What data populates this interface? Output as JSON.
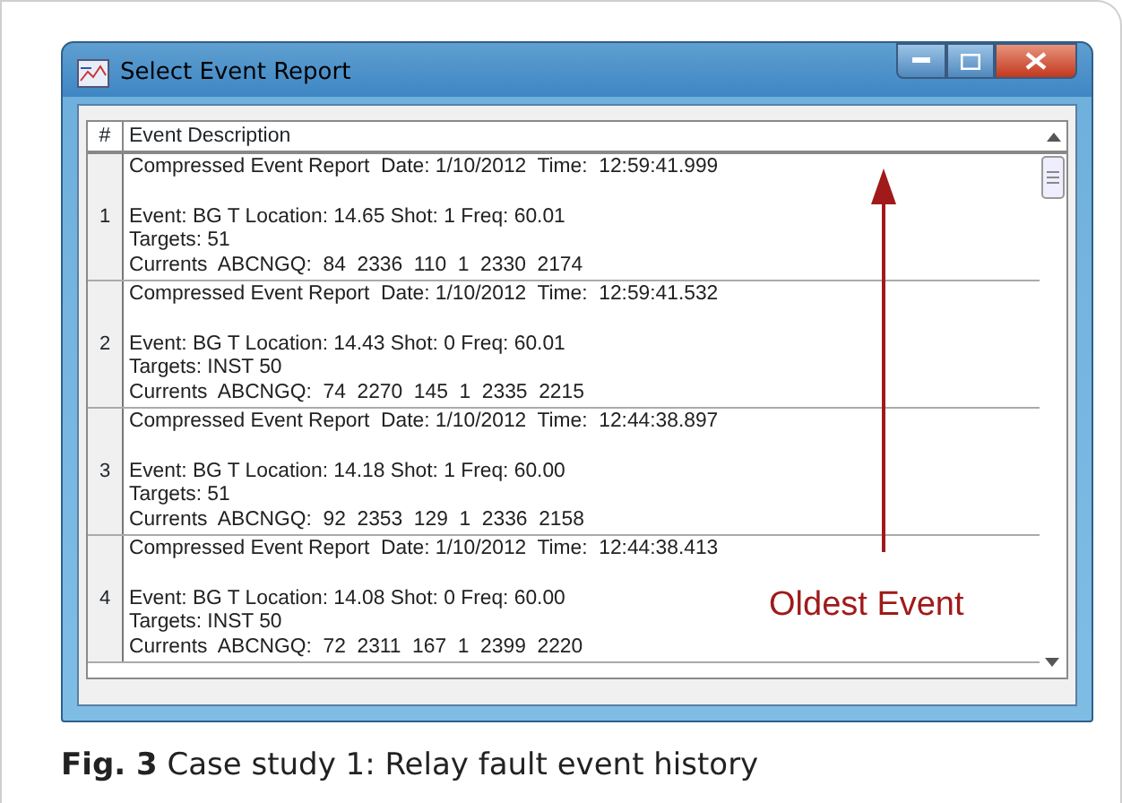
{
  "window": {
    "title": "Select Event Report"
  },
  "table": {
    "columns": [
      "#",
      "Event Description"
    ],
    "rows": [
      {
        "number": "1",
        "lines": [
          "Compressed Event Report  Date: 1/10/2012  Time:  12:59:41.999",
          "Event: BG T Location: 14.65 Shot: 1 Freq: 60.01",
          "Targets: 51",
          "Currents  ABCNGQ:  84  2336  110  1  2330  2174"
        ]
      },
      {
        "number": "2",
        "lines": [
          "Compressed Event Report  Date: 1/10/2012  Time:  12:59:41.532",
          "Event: BG T Location: 14.43 Shot: 0 Freq: 60.01",
          "Targets: INST 50",
          "Currents  ABCNGQ:  74  2270  145  1  2335  2215"
        ]
      },
      {
        "number": "3",
        "lines": [
          "Compressed Event Report  Date: 1/10/2012  Time:  12:44:38.897",
          "Event: BG T Location: 14.18 Shot: 1 Freq: 60.00",
          "Targets: 51",
          "Currents  ABCNGQ:  92  2353  129  1  2336  2158"
        ]
      },
      {
        "number": "4",
        "lines": [
          "Compressed Event Report  Date: 1/10/2012  Time:  12:44:38.413",
          "Event: BG T Location: 14.08 Shot: 0 Freq: 60.00",
          "Targets: INST 50",
          "Currents  ABCNGQ:  72  2311  167  1  2399  2220"
        ]
      }
    ]
  },
  "annotation": {
    "text": "Oldest Event"
  },
  "caption": "**Fig. 3** Case study 1: Relay fault event history"
}
